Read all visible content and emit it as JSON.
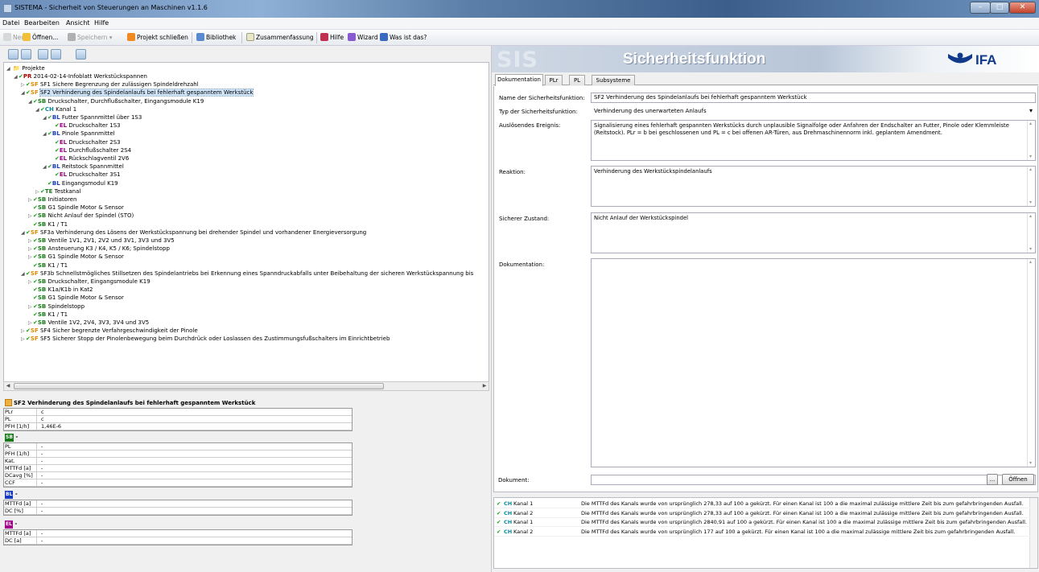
{
  "window": {
    "title": "SISTEMA - Sicherheit von Steuerungen an Maschinen v1.1.6"
  },
  "menu": [
    "Datei",
    "Bearbeiten",
    "Ansicht",
    "Hilfe"
  ],
  "toolbar": {
    "neu": "Neu",
    "oeffnen": "Öffnen...",
    "speichern": "Speichern",
    "projekt_schliessen": "Projekt schließen",
    "bibliothek": "Bibliothek",
    "zusammenfassung": "Zusammenfassung",
    "hilfe": "Hilfe",
    "wizard": "Wizard",
    "was_ist_das": "Was ist das?"
  },
  "tree": {
    "root": "Projekte",
    "nodes": [
      {
        "abbr": "PR",
        "cls": "c-pr",
        "label": "2014-02-14-Infoblatt Werkstückspannen",
        "exp": "◢",
        "check": true
      },
      {
        "abbr": "SF",
        "cls": "c-sf",
        "label": "SF1 Sichere Begrenzung der zulässigen Spindeldrehzahl",
        "exp": "▷",
        "check": true
      },
      {
        "abbr": "SF",
        "cls": "c-sf",
        "label": "SF2 Verhinderung des Spindelanlaufs bei fehlerhaft gespanntem Werkstück",
        "exp": "◢",
        "check": true
      },
      {
        "abbr": "SB",
        "cls": "c-sb",
        "label": "Druckschalter, Durchflußschalter, Eingangsmodule K19",
        "exp": "◢",
        "check": true
      },
      {
        "abbr": "CH",
        "cls": "c-ch",
        "label": "Kanal 1",
        "exp": "◢",
        "check": true
      },
      {
        "abbr": "BL",
        "cls": "c-bl",
        "label": "Futter Spannmittel über 1S3",
        "exp": "◢",
        "check": true
      },
      {
        "abbr": "EL",
        "cls": "c-el",
        "label": "Druckschalter 1S3",
        "exp": "",
        "check": true
      },
      {
        "abbr": "BL",
        "cls": "c-bl",
        "label": "Pinole Spannmittel",
        "exp": "◢",
        "check": true
      },
      {
        "abbr": "EL",
        "cls": "c-el",
        "label": "Druckschalter 2S3",
        "exp": "",
        "check": true
      },
      {
        "abbr": "EL",
        "cls": "c-el",
        "label": "Durchflußschalter 2S4",
        "exp": "",
        "check": true
      },
      {
        "abbr": "EL",
        "cls": "c-el",
        "label": "Rückschlagventil 2V6",
        "exp": "",
        "check": true
      },
      {
        "abbr": "BL",
        "cls": "c-bl",
        "label": "Reitstock Spannmittel",
        "exp": "◢",
        "check": true
      },
      {
        "abbr": "EL",
        "cls": "c-el",
        "label": "Druckschalter 3S1",
        "exp": "",
        "check": true
      },
      {
        "abbr": "BL",
        "cls": "c-bl",
        "label": "Eingangsmodul K19",
        "exp": "",
        "check": true
      },
      {
        "abbr": "TE",
        "cls": "c-te",
        "label": "Testkanal",
        "exp": "▷",
        "check": true
      },
      {
        "abbr": "SB",
        "cls": "c-sb",
        "label": "Initiatoren",
        "exp": "▷",
        "check": true
      },
      {
        "abbr": "SB",
        "cls": "c-sb",
        "label": "G1 Spindle Motor & Sensor",
        "exp": "",
        "check": true
      },
      {
        "abbr": "SB",
        "cls": "c-sb",
        "label": "Nicht Anlauf der Spindel (STO)",
        "exp": "▷",
        "check": true
      },
      {
        "abbr": "SB",
        "cls": "c-sb",
        "label": "K1 / T1",
        "exp": "",
        "check": true
      },
      {
        "abbr": "SF",
        "cls": "c-sf",
        "label": "SF3a Verhinderung des Lösens der Werkstückspannung bei drehender Spindel und vorhandener Energieversorgung",
        "exp": "◢",
        "check": true
      },
      {
        "abbr": "SB",
        "cls": "c-sb",
        "label": "Ventile 1V1, 2V1, 2V2 und 3V1, 3V3 und 3V5",
        "exp": "▷",
        "check": true
      },
      {
        "abbr": "SB",
        "cls": "c-sb",
        "label": "Ansteuerung K3 / K4, K5 / K6; Spindelstopp",
        "exp": "▷",
        "check": true
      },
      {
        "abbr": "SB",
        "cls": "c-sb",
        "label": "G1 Spindle Motor & Sensor",
        "exp": "▷",
        "check": true
      },
      {
        "abbr": "SB",
        "cls": "c-sb",
        "label": "K1 / T1",
        "exp": "",
        "check": true
      },
      {
        "abbr": "SF",
        "cls": "c-sf",
        "label": "SF3b Schnellstmögliches Stillsetzen des Spindelantriebs bei Erkennung eines Spanndruckabfalls unter Beibehaltung der sicheren Werkstückspannung bis",
        "exp": "◢",
        "check": true
      },
      {
        "abbr": "SB",
        "cls": "c-sb",
        "label": "Druckschalter, Eingangsmodule K19",
        "exp": "▷",
        "check": true
      },
      {
        "abbr": "SB",
        "cls": "c-sb",
        "label": "K1a/K1b in Kat2",
        "exp": "",
        "check": true
      },
      {
        "abbr": "SB",
        "cls": "c-sb",
        "label": "G1 Spindle Motor & Sensor",
        "exp": "",
        "check": true
      },
      {
        "abbr": "SB",
        "cls": "c-sb",
        "label": "Spindelstopp",
        "exp": "▷",
        "check": true
      },
      {
        "abbr": "SB",
        "cls": "c-sb",
        "label": "K1 / T1",
        "exp": "",
        "check": true
      },
      {
        "abbr": "SB",
        "cls": "c-sb",
        "label": "Ventile 1V2, 2V4, 3V3, 3V4 und 3V5",
        "exp": "▷",
        "check": true
      },
      {
        "abbr": "SF",
        "cls": "c-sf",
        "label": "SF4 Sicher begrenzte Verfahrgeschwindigkeit der Pinole",
        "exp": "▷",
        "check": true
      },
      {
        "abbr": "SF",
        "cls": "c-sf",
        "label": "SF5 Sicherer Stopp der Pinolenbewegung beim Durchdrück oder Loslassen des Zustimmungsfußschalters im Einrichtbetrieb",
        "exp": "▷",
        "check": true
      }
    ]
  },
  "summary": {
    "title": "SF2 Verhinderung des Spindelanlaufs bei fehlerhaft gespanntem Werkstück",
    "sf_rows": [
      {
        "k": "PLr",
        "v": "c"
      },
      {
        "k": "PL",
        "v": "c"
      },
      {
        "k": "PFH [1/h]",
        "v": "1,46E-6"
      }
    ],
    "sb_label": "SB",
    "sb_value": "-",
    "sb_rows": [
      {
        "k": "PL",
        "v": "-"
      },
      {
        "k": "PFH [1/h]",
        "v": "-"
      },
      {
        "k": "Kat.",
        "v": "-"
      },
      {
        "k": "MTTFd [a]",
        "v": "-"
      },
      {
        "k": "DCavg [%]",
        "v": "-"
      },
      {
        "k": "CCF",
        "v": "-"
      }
    ],
    "bl_label": "BL",
    "bl_value": "-",
    "bl_rows": [
      {
        "k": "MTTFd [a]",
        "v": "-"
      },
      {
        "k": "DC [%]",
        "v": "-"
      }
    ],
    "el_label": "EL",
    "el_value": "-",
    "el_rows": [
      {
        "k": "MTTFd [a]",
        "v": "-"
      },
      {
        "k": "DC [a]",
        "v": "-"
      }
    ]
  },
  "banner": {
    "title": "Sicherheitsfunktion",
    "watermark": "SIS",
    "logo": "IFA"
  },
  "tabs": [
    "Dokumentation",
    "PLr",
    "PL",
    "Subsysteme"
  ],
  "form": {
    "name_label": "Name der Sicherheitsfunktion:",
    "name_value": "SF2 Verhinderung des Spindelanlaufs bei fehlerhaft gespanntem Werkstück",
    "typ_label": "Typ der Sicherheitsfunktion:",
    "typ_value": "Verhinderung des unerwarteten Anlaufs",
    "ereignis_label": "Auslösendes Ereignis:",
    "ereignis_value": "Signalisierung eines fehlerhaft gespannten Werkstücks durch unplausible Signalfolge oder Anfahren der Endschalter an Futter, Pinole oder Klemmleiste (Reitstock). PLr = b bei geschlossenen und PL = c bei offenen AR-Türen, aus Drehmaschinennorm inkl. geplantem Amendment.",
    "reaktion_label": "Reaktion:",
    "reaktion_value": "Verhinderung des Werkstückspindelanlaufs",
    "zustand_label": "Sicherer Zustand:",
    "zustand_value": "Nicht Anlauf der Werkstückspindel",
    "doku_label": "Dokumentation:",
    "dokument_label": "Dokument:",
    "browse": "...",
    "oeffnen": "Öffnen"
  },
  "messages": [
    {
      "ch": "CH",
      "name": "Kanal 1",
      "text": "Die MTTFd des Kanals wurde von ursprünglich 278,33 auf 100 a gekürzt. Für einen Kanal ist 100 a die maximal zulässige mittlere Zeit bis zum gefahrbringenden Ausfall."
    },
    {
      "ch": "CH",
      "name": "Kanal 2",
      "text": "Die MTTFd des Kanals wurde von ursprünglich 278,33 auf 100 a gekürzt. Für einen Kanal ist 100 a die maximal zulässige mittlere Zeit bis zum gefahrbringenden Ausfall."
    },
    {
      "ch": "CH",
      "name": "Kanal 1",
      "text": "Die MTTFd des Kanals wurde von ursprünglich 2840,91 auf 100 a gekürzt. Für einen Kanal ist 100 a die maximal zulässige mittlere Zeit bis zum gefahrbringenden Ausfall."
    },
    {
      "ch": "CH",
      "name": "Kanal 2",
      "text": "Die MTTFd des Kanals wurde von ursprünglich 177 auf 100 a gekürzt. Für einen Kanal ist 100 a die maximal zulässige mittlere Zeit bis zum gefahrbringenden Ausfall."
    }
  ],
  "colors": {
    "ifa_blue": "#123a8a",
    "check_green": "#1aa01a",
    "sf_orange": "#e08b00"
  }
}
